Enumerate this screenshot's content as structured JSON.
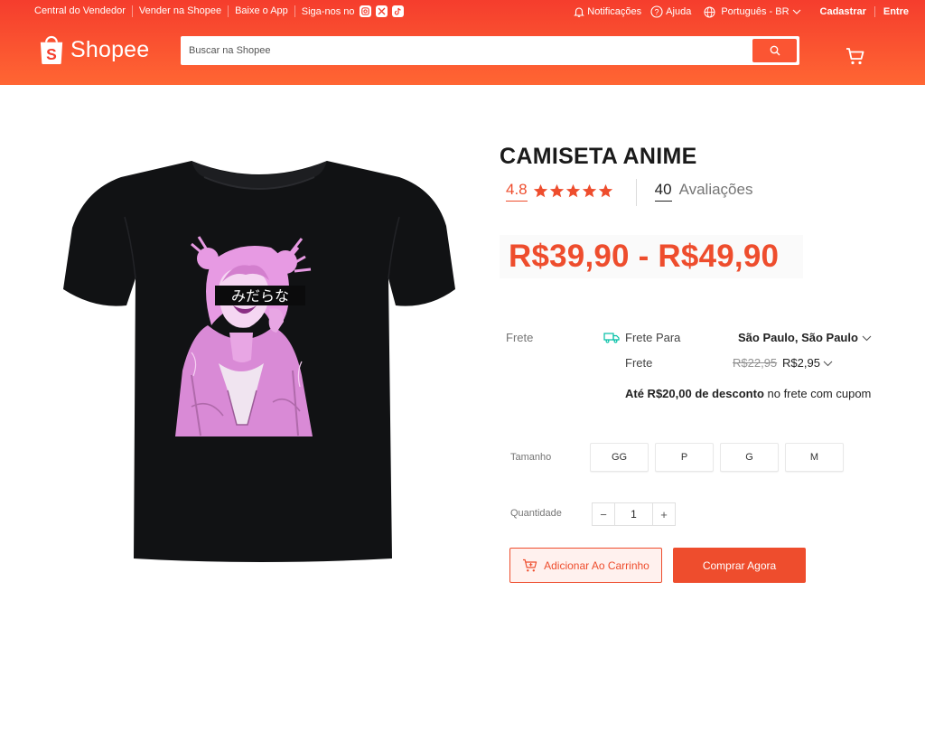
{
  "topbar": {
    "left_links": [
      "Central do Vendedor",
      "Vender na Shopee",
      "Baixe o App"
    ],
    "follow_label": "Siga-nos no",
    "social_icons": [
      "instagram-icon",
      "x-icon",
      "tiktok-icon"
    ],
    "notifications": "Notificações",
    "help": "Ajuda",
    "language": "Português - BR",
    "register": "Cadastrar",
    "login": "Entre"
  },
  "header": {
    "logo_text": "Shopee",
    "search_placeholder": "Buscar na Shopee"
  },
  "product": {
    "title": "CAMISETA ANIME",
    "image_text": "みだらな",
    "rating": "4.8",
    "stars": 5,
    "review_count": "40",
    "review_label": "Avaliações",
    "price": "R$39,90 - R$49,90"
  },
  "shipping": {
    "label": "Frete",
    "to_label": "Frete Para",
    "location": "São Paulo, São Paulo",
    "fee_label": "Frete",
    "old_fee": "R$22,95",
    "new_fee": "R$2,95",
    "promo_prefix": "Até R$20,00 de desconto",
    "promo_suffix": " no frete com cupom"
  },
  "size": {
    "label": "Tamanho",
    "options": [
      "GG",
      "P",
      "G",
      "M"
    ]
  },
  "quantity": {
    "label": "Quantidade",
    "minus": "−",
    "value": "1",
    "plus": "+"
  },
  "actions": {
    "add_to_cart": "Adicionar Ao Carrinho",
    "buy_now": "Comprar Agora"
  },
  "colors": {
    "brand": "#ee4d2d",
    "header_top": "#f53d2d",
    "header_bottom": "#ff6633",
    "shipping_teal": "#00bfa5"
  }
}
